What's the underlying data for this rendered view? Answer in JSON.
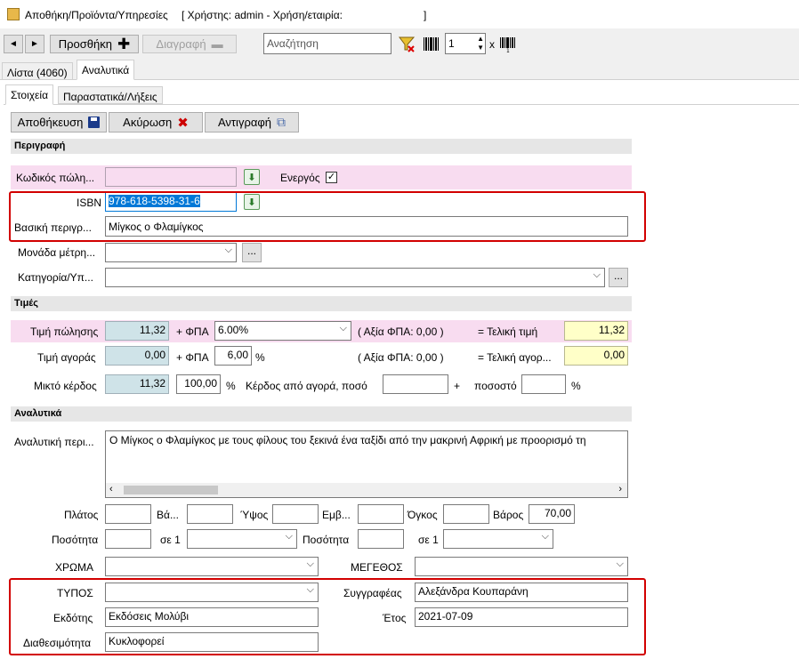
{
  "window": {
    "title": "Αποθήκη/Προϊόντα/Υπηρεσίες",
    "user_info": "[ Χρήστης: admin - Χρήση/εταιρία:",
    "user_info_end": "]"
  },
  "toolbar": {
    "prev": "◄",
    "next": "►",
    "add_label": "Προσθήκη",
    "delete_label": "Διαγραφή",
    "search_placeholder": "Αναζήτηση",
    "quantity": "1",
    "times": "x"
  },
  "main_tabs": [
    {
      "label": "Λίστα (4060)"
    },
    {
      "label": "Αναλυτικά"
    }
  ],
  "sub_tabs": [
    {
      "label": "Στοιχεία"
    },
    {
      "label": "Παραστατικά/Λήξεις"
    }
  ],
  "actions": {
    "save": "Αποθήκευση",
    "cancel": "Ακύρωση",
    "copy": "Αντιγραφή"
  },
  "description_section": {
    "title": "Περιγραφή",
    "sale_code_label": "Κωδικός πώλη...",
    "sale_code": "",
    "active_label": "Ενεργός",
    "active_check": "✓",
    "isbn_label": "ISBN",
    "isbn": "978-618-5398-31-6",
    "basic_desc_label": "Βασική περιγρ...",
    "basic_desc": "Μίγκος ο Φλαμίγκος",
    "unit_label": "Μονάδα μέτρη...",
    "category_label": "Κατηγορία/Υπ...",
    "dots": "..."
  },
  "prices": {
    "title": "Τιμές",
    "sale_label": "Τιμή πώλησης",
    "sale_price": "11,32",
    "plus_vat": "+ ΦΠΑ",
    "vat_select": "6.00%",
    "vat_value_text": "( Αξία ΦΠΑ: 0,00 )",
    "final_label": "= Τελική τιμή",
    "final_price": "11,32",
    "buy_label": "Τιμή αγοράς",
    "buy_price": "0,00",
    "buy_vat": "6,00",
    "percent": "%",
    "buy_vat_value_text": "( Αξία ΦΠΑ: 0,00 )",
    "buy_final_label": "= Τελική αγορ...",
    "buy_final": "0,00",
    "gross_label": "Μικτό κέρδος",
    "gross_profit": "11,32",
    "gross_pct": "100,00",
    "profit_from_buy_label": "Κέρδος από αγορά, ποσό",
    "plus": "+",
    "pososto_label": "ποσοστό"
  },
  "analytics": {
    "title": "Αναλυτικά",
    "detailed_label": "Αναλυτική περι...",
    "detailed_text": "Ο Μίγκος ο Φλαμίγκος με τους φίλους του ξεκινά ένα ταξίδι από την μακρινή Αφρική με προορισμό τη",
    "width_label": "Πλάτος",
    "ba_label": "Βά...",
    "height_label": "Ύψος",
    "area_label": "Εμβ...",
    "volume_label": "Όγκος",
    "weight_label": "Βάρος",
    "weight": "70,00",
    "qty_label": "Ποσότητα",
    "se1_label": "σε 1",
    "qty2_label": "Ποσότητα",
    "se1b_label": "σε 1",
    "color_label": "ΧΡΩΜΑ",
    "size_label": "ΜΕΓΕΘΟΣ",
    "type_label": "ΤΥΠΟΣ",
    "author_label": "Συγγραφέας",
    "author": "Αλεξάνδρα Κουπαράνη",
    "publisher_label": "Εκδότης",
    "publisher": "Εκδόσεις Μολύβι",
    "year_label": "Έτος",
    "year": "2021-07-09",
    "availability_label": "Διαθεσιμότητα",
    "availability": "Κυκλοφορεί"
  }
}
